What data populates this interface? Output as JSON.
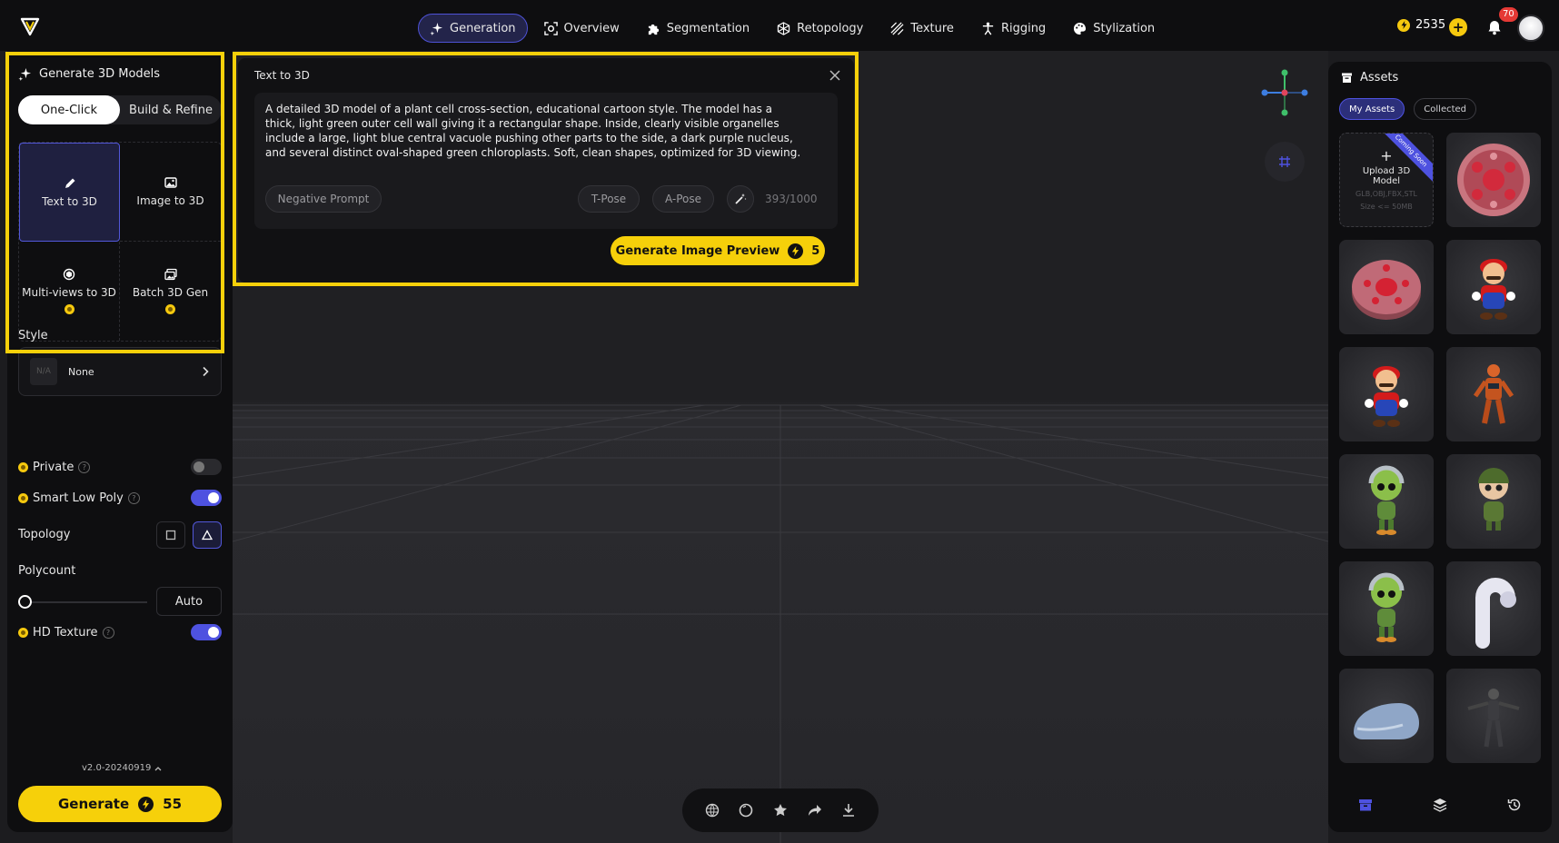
{
  "nav": {
    "items": [
      {
        "label": "Generation",
        "icon": "sparkle-icon",
        "active": true
      },
      {
        "label": "Overview",
        "icon": "scan-icon"
      },
      {
        "label": "Segmentation",
        "icon": "puzzle-icon"
      },
      {
        "label": "Retopology",
        "icon": "mesh-icon"
      },
      {
        "label": "Texture",
        "icon": "texture-icon"
      },
      {
        "label": "Rigging",
        "icon": "figure-icon"
      },
      {
        "label": "Stylization",
        "icon": "palette-icon"
      }
    ],
    "credits": "2535",
    "notification_count": "70"
  },
  "left": {
    "title": "Generate 3D Models",
    "segments": [
      "One-Click",
      "Build & Refine"
    ],
    "modes": [
      {
        "label": "Text to 3D",
        "icon": "pencil-icon",
        "active": true
      },
      {
        "label": "Image to 3D",
        "icon": "image-icon"
      },
      {
        "label": "Multi-views to 3D",
        "icon": "multiview-icon",
        "paid": true
      },
      {
        "label": "Batch 3D Gen",
        "icon": "batch-icon",
        "paid": true
      }
    ],
    "style_label": "Style",
    "style_thumb": "N/A",
    "style_value": "None",
    "private_label": "Private",
    "private_on": false,
    "smart_low_poly_label": "Smart Low Poly",
    "smart_low_poly_on": true,
    "topology_label": "Topology",
    "polycount_label": "Polycount",
    "polycount_value": "Auto",
    "hd_texture_label": "HD Texture",
    "hd_texture_on": true,
    "version": "v2.0-20240919",
    "generate_label": "Generate",
    "generate_cost": "55"
  },
  "card": {
    "title": "Text to 3D",
    "prompt": "A detailed 3D model of a plant cell cross-section, educational cartoon style. The model has a thick, light green outer cell wall giving it a rectangular shape. Inside, clearly visible organelles include a large, light blue central vacuole pushing other parts to the side, a dark purple nucleus, and several distinct oval-shaped green chloroplasts. Soft, clean shapes, optimized for 3D viewing.",
    "negative_prompt": "Negative Prompt",
    "t_pose": "T-Pose",
    "a_pose": "A-Pose",
    "counter": "393/1000",
    "preview_label": "Generate Image Preview",
    "preview_cost": "5"
  },
  "assets": {
    "title": "Assets",
    "tabs": [
      "My Assets",
      "Collected"
    ],
    "upload_title": "Upload 3D Model",
    "upload_formats": "GLB,OBJ,FBX,STL",
    "upload_size": "Size <= 50MB",
    "coming_soon": "Coming Soon",
    "items": [
      "cell-model",
      "cell-model-flat",
      "mario-figure",
      "mario-figure",
      "orange-robot",
      "alien-kid",
      "soldier-kid",
      "alien-kid",
      "white-pipe",
      "blue-capsule",
      "dark-armor-figure"
    ]
  },
  "colors": {
    "accent": "#4e52e0",
    "highlight": "#f6d00a",
    "bg": "#1c1c1f",
    "panel": "#0e0e10"
  }
}
